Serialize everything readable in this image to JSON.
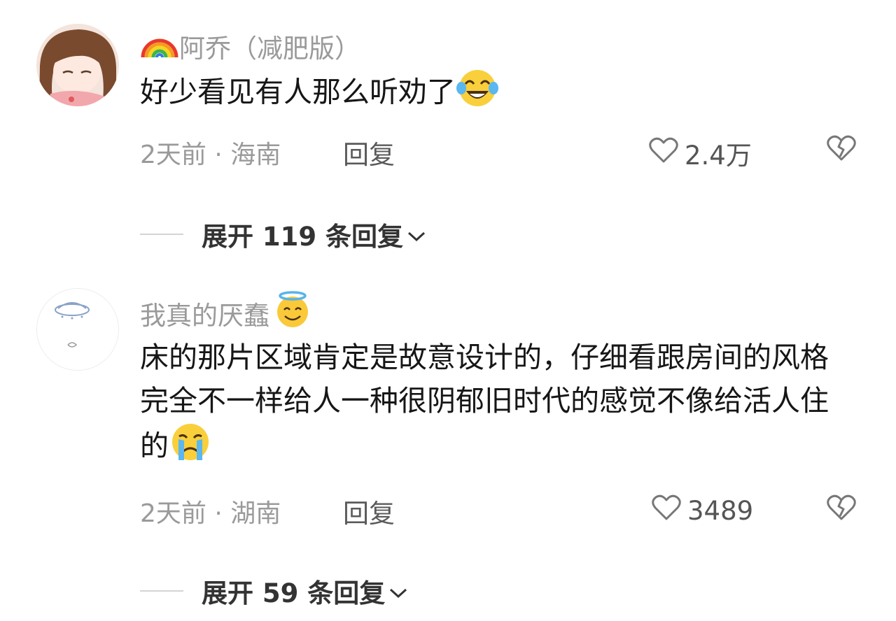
{
  "comments": [
    {
      "username": "阿乔（减肥版）",
      "username_prefix_icon": "rainbow-icon",
      "text": "好少看见有人那么听劝了",
      "text_emoji": "laugh-cry-emoji",
      "time_location": "2天前 · 海南",
      "reply_label": "回复",
      "likes": "2.4万",
      "expand_label": "展开 119 条回复"
    },
    {
      "username": "我真的厌蠢",
      "username_suffix_icon": "halo-smile-emoji",
      "text": "床的那片区域肯定是故意设计的，仔细看跟房间的风格完全不一样给人一种很阴郁旧时代的感觉不像给活人住的",
      "text_emoji": "crying-emoji",
      "time_location": "2天前 · 湖南",
      "reply_label": "回复",
      "likes": "3489",
      "expand_label": "展开 59 条回复"
    }
  ]
}
